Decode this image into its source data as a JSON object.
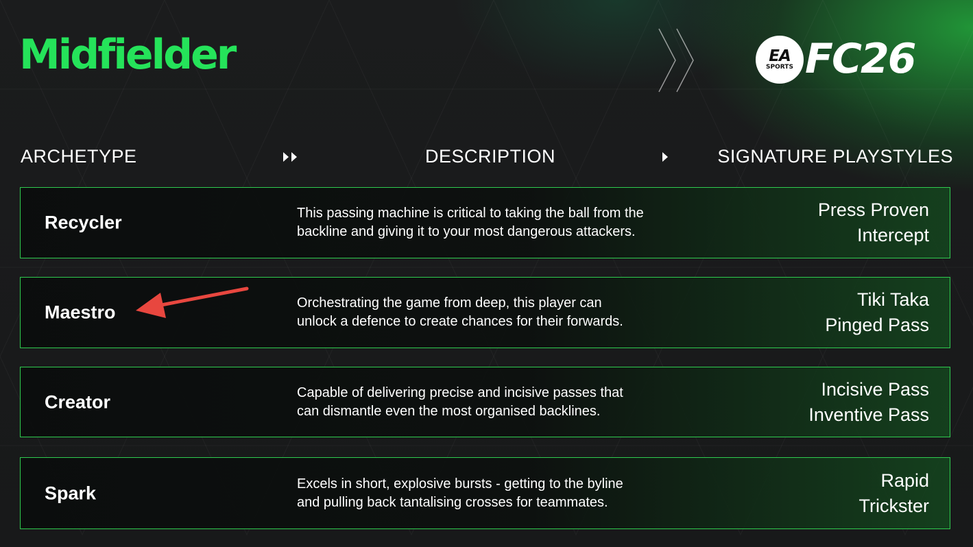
{
  "page": {
    "title": "Midfielder"
  },
  "logo": {
    "ea_main": "EA",
    "ea_sub": "SPORTS",
    "fc": "FC26"
  },
  "headers": {
    "archetype": "ARCHETYPE",
    "description": "DESCRIPTION",
    "signature": "SIGNATURE  PLAYSTYLES"
  },
  "rows": [
    {
      "name": "Recycler",
      "desc": [
        "This passing machine is critical to taking the ball from the",
        "backline and giving it to your most dangerous attackers."
      ],
      "playstyles": [
        "Press Proven",
        "Intercept"
      ]
    },
    {
      "name": "Maestro",
      "desc": [
        "Orchestrating the game from deep, this player can",
        "unlock a defence to create chances for their forwards."
      ],
      "playstyles": [
        "Tiki Taka",
        "Pinged Pass"
      ]
    },
    {
      "name": "Creator",
      "desc": [
        "Capable of delivering precise and incisive passes that",
        "can dismantle even the most organised backlines."
      ],
      "playstyles": [
        "Incisive Pass",
        "Inventive Pass"
      ]
    },
    {
      "name": "Spark",
      "desc": [
        "Excels in short, explosive bursts - getting to the byline",
        "and pulling back tantalising crosses for teammates."
      ],
      "playstyles": [
        "Rapid",
        "Trickster"
      ]
    }
  ],
  "colors": {
    "accent": "#25e35a",
    "border": "#2fcc4f",
    "annotation_arrow": "#e8473f"
  },
  "annotation": {
    "icon": "red-arrow-icon"
  }
}
